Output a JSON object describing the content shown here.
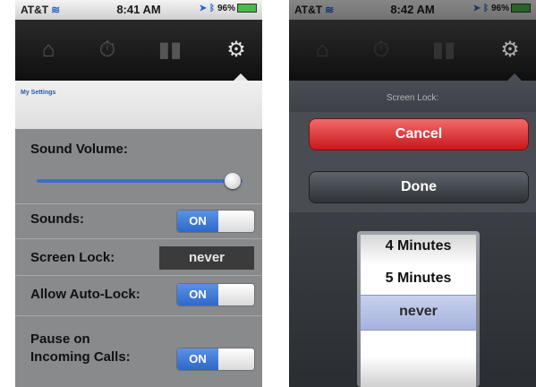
{
  "left": {
    "status": {
      "carrier": "AT&T",
      "time": "8:41 AM",
      "battery": "96%"
    },
    "tabs": [
      "home-icon",
      "stopwatch-icon",
      "chart-icon",
      "gear-icon"
    ],
    "breadcrumb": "My Settings",
    "settings": {
      "sound_volume_label": "Sound Volume:",
      "sound_volume_value": 0.95,
      "sounds_label": "Sounds:",
      "sounds_state": "ON",
      "screen_lock_label": "Screen Lock:",
      "screen_lock_value": "never",
      "auto_lock_label": "Allow Auto-Lock:",
      "auto_lock_state": "ON",
      "pause_label_line1": "Pause on",
      "pause_label_line2": "Incoming Calls:",
      "pause_state": "ON"
    }
  },
  "right": {
    "status": {
      "carrier": "AT&T",
      "time": "8:42 AM",
      "battery": "96%"
    },
    "sheet_title": "Screen Lock:",
    "cancel_label": "Cancel",
    "done_label": "Done",
    "picker": {
      "items": [
        "4 Minutes",
        "5 Minutes",
        "never"
      ],
      "selected": "never"
    }
  },
  "colors": {
    "accent_blue": "#2f68c9",
    "cancel_red": "#d9252a"
  }
}
